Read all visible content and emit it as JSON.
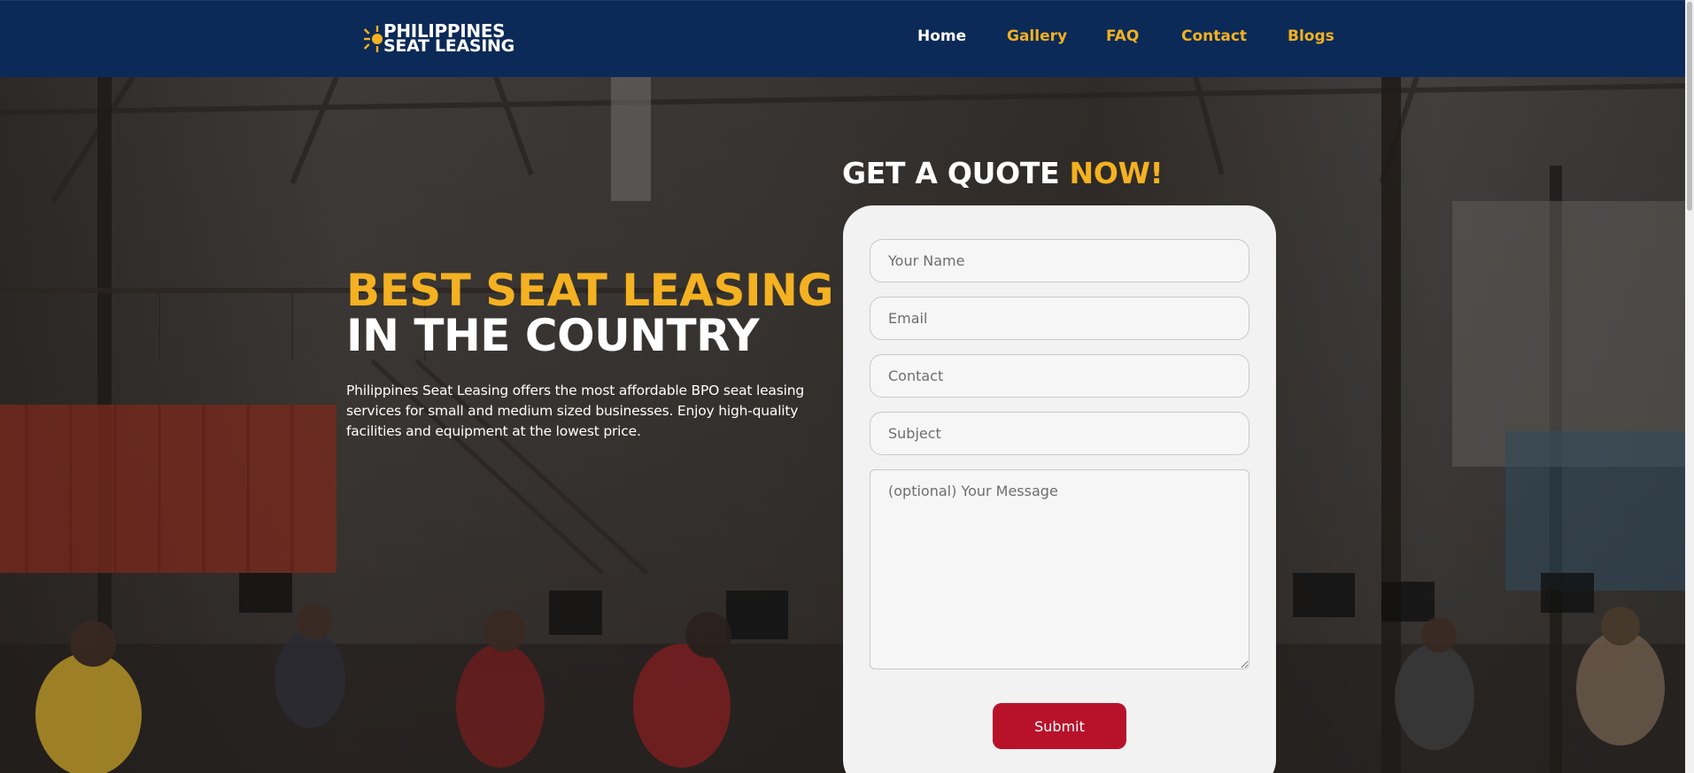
{
  "header": {
    "logo": {
      "line1": "PHILIPPINES",
      "line2": "SEAT LEASING"
    },
    "nav": [
      {
        "label": "Home",
        "active": true
      },
      {
        "label": "Gallery",
        "active": false
      },
      {
        "label": "FAQ",
        "active": false
      },
      {
        "label": "Contact",
        "active": false
      },
      {
        "label": "Blogs",
        "active": false
      }
    ]
  },
  "hero": {
    "title_line1": "BEST SEAT LEASING",
    "title_line2": "IN THE COUNTRY",
    "description": "Philippines Seat Leasing offers the most affordable BPO seat leasing services for small and medium sized businesses. Enjoy high-quality facilities and equipment at the lowest price."
  },
  "quote_form": {
    "heading_main": "GET A QUOTE ",
    "heading_accent": "NOW!",
    "fields": {
      "name_placeholder": "Your Name",
      "email_placeholder": "Email",
      "contact_placeholder": "Contact",
      "subject_placeholder": "Subject",
      "message_placeholder": "(optional) Your Message"
    },
    "submit_label": "Submit"
  },
  "colors": {
    "header_bg": "#0b2a57",
    "accent_yellow": "#f4b121",
    "submit_red": "#b8122b",
    "form_bg": "#f2f2f2"
  }
}
